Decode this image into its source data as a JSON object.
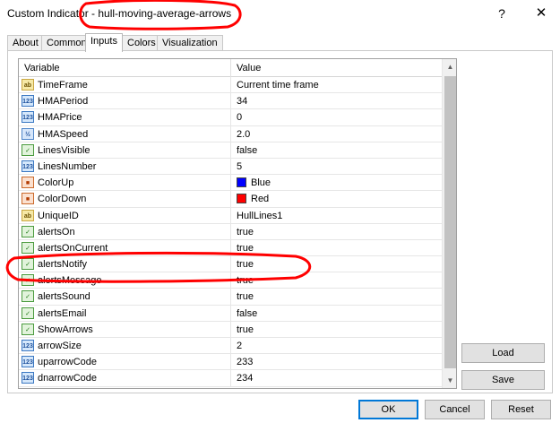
{
  "window": {
    "title": "Custom Indicator - hull-moving-average-arrows",
    "help_glyph": "?",
    "close_glyph": "✕"
  },
  "tabs": [
    "About",
    "Common",
    "Inputs",
    "Colors",
    "Visualization"
  ],
  "active_tab": "Inputs",
  "grid": {
    "columns": [
      "Variable",
      "Value"
    ],
    "rows": [
      {
        "type": "ab",
        "name": "TimeFrame",
        "value": "Current time frame"
      },
      {
        "type": "123",
        "name": "HMAPeriod",
        "value": "34"
      },
      {
        "type": "123",
        "name": "HMAPrice",
        "value": "0"
      },
      {
        "type": "1/2",
        "name": "HMASpeed",
        "value": "2.0"
      },
      {
        "type": "bool",
        "name": "LinesVisible",
        "value": "false"
      },
      {
        "type": "123",
        "name": "LinesNumber",
        "value": "5"
      },
      {
        "type": "clr",
        "name": "ColorUp",
        "value": "Blue",
        "swatch": "#0000ff"
      },
      {
        "type": "clr",
        "name": "ColorDown",
        "value": "Red",
        "swatch": "#ff0000"
      },
      {
        "type": "ab",
        "name": "UniqueID",
        "value": "HullLines1"
      },
      {
        "type": "bool",
        "name": "alertsOn",
        "value": "true"
      },
      {
        "type": "bool",
        "name": "alertsOnCurrent",
        "value": "true"
      },
      {
        "type": "bool",
        "name": "alertsNotify",
        "value": "true"
      },
      {
        "type": "bool",
        "name": "alertsMessage",
        "value": "true"
      },
      {
        "type": "bool",
        "name": "alertsSound",
        "value": "true"
      },
      {
        "type": "bool",
        "name": "alertsEmail",
        "value": "false"
      },
      {
        "type": "bool",
        "name": "ShowArrows",
        "value": "true"
      },
      {
        "type": "123",
        "name": "arrowSize",
        "value": "2"
      },
      {
        "type": "123",
        "name": "uparrowCode",
        "value": "233"
      },
      {
        "type": "123",
        "name": "dnarrowCode",
        "value": "234"
      }
    ]
  },
  "buttons": {
    "load": "Load",
    "save": "Save",
    "ok": "OK",
    "cancel": "Cancel",
    "reset": "Reset"
  },
  "annotation_color": "#ff0000"
}
